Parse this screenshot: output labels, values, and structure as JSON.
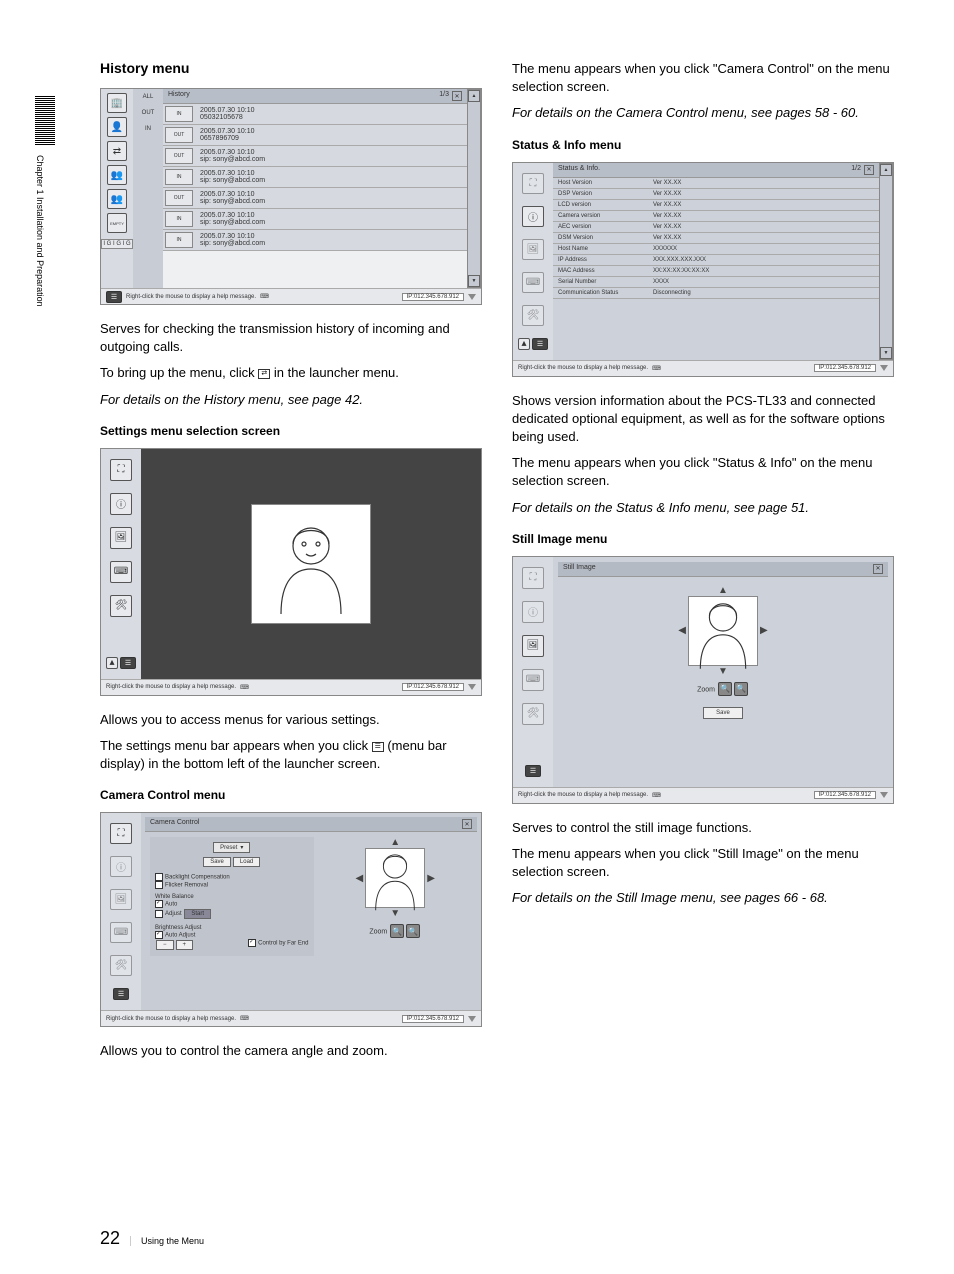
{
  "sidebarLabel": "Chapter 1  Installation and Preparation",
  "pageNumber": "22",
  "footerText": "Using the Menu",
  "left": {
    "history": {
      "heading": "History menu",
      "ss": {
        "title": "History",
        "pageInfo": "1/3",
        "filters": [
          "ALL",
          "OUT",
          "IN"
        ],
        "rows": [
          {
            "dir": "IN",
            "l1": "2005.07.30 10:10",
            "l2": "05032105678"
          },
          {
            "dir": "OUT",
            "l1": "2005.07.30 10:10",
            "l2": "0657896709"
          },
          {
            "dir": "OUT",
            "l1": "2005.07.30 10:10",
            "l2": "sip: sony@abcd.com"
          },
          {
            "dir": "IN",
            "l1": "2005.07.30 10:10",
            "l2": "sip: sony@abcd.com"
          },
          {
            "dir": "OUT",
            "l1": "2005.07.30 10:10",
            "l2": "sip: sony@abcd.com"
          },
          {
            "dir": "IN",
            "l1": "2005.07.30 10:10",
            "l2": "sip: sony@abcd.com"
          },
          {
            "dir": "IN",
            "l1": "2005.07.30 10:10",
            "l2": "sip: sony@abcd.com"
          }
        ],
        "launcherBadges": "I G I G I G",
        "help": "Right-click the mouse to display a help message.",
        "ip": "IP:012.345.678.912"
      },
      "p1": "Serves for checking the transmission history of incoming and outgoing calls.",
      "p2a": "To bring up the menu, click ",
      "p2b": " in the launcher menu.",
      "p3": "For details on the History menu, see page 42."
    },
    "settings": {
      "heading": "Settings menu selection screen",
      "ss": {
        "help": "Right-click the mouse to display a help message.",
        "ip": "IP:012.345.678.912"
      },
      "p1": "Allows you to access menus for various settings.",
      "p2a": "The settings menu bar appears when you click ",
      "p2b": " (menu bar display) in the bottom left of the launcher screen.",
      "h3": "Camera Control menu"
    },
    "camera": {
      "ss": {
        "title": "Camera Control",
        "preset": "Preset",
        "save": "Save",
        "load": "Load",
        "backlight": "Backlight Compensation",
        "flicker": "Flicker Removal",
        "wb": "White Balance",
        "auto": "Auto",
        "adjust": "Adjust",
        "start": "Start",
        "brightness": "Brightness Adjust",
        "autoAdjust": "Auto Adjust",
        "ctrlFar": "Control by Far End",
        "zoom": "Zoom",
        "help": "Right-click the mouse to display a help message.",
        "ip": "IP:012.345.678.912"
      },
      "p1": "Allows you to control the camera angle and zoom."
    }
  },
  "right": {
    "topP1": "The menu appears when you click \"Camera Control\" on the menu selection screen.",
    "topP2": "For details on the Camera Control menu, see pages 58 - 60.",
    "status": {
      "heading": "Status & Info menu",
      "ss": {
        "title": "Status & Info.",
        "pageInfo": "1/2",
        "rows": [
          {
            "k": "Host Version",
            "v": "Ver XX.XX"
          },
          {
            "k": "DSP Version",
            "v": "Ver XX.XX"
          },
          {
            "k": "LCD version",
            "v": "Ver XX.XX"
          },
          {
            "k": "Camera version",
            "v": "Ver XX.XX"
          },
          {
            "k": "AEC version",
            "v": "Ver XX.XX"
          },
          {
            "k": "DSM Version",
            "v": "Ver XX.XX"
          },
          {
            "k": "Host Name",
            "v": "XXXXXX"
          },
          {
            "k": "IP Address",
            "v": "XXX.XXX.XXX.XXX"
          },
          {
            "k": "MAC Address",
            "v": "XX:XX:XX:XX:XX:XX"
          },
          {
            "k": "Serial Number",
            "v": "XXXX"
          },
          {
            "k": "Communication Status",
            "v": "Disconnecting"
          }
        ],
        "help": "Right-click the mouse to display a help message.",
        "ip": "IP:012.345.678.912"
      },
      "p1": "Shows version information about the PCS-TL33 and connected dedicated optional equipment, as well as for the software options being used.",
      "p2": "The menu appears when you click \"Status & Info\" on the menu selection screen.",
      "p3": "For details on the Status & Info menu, see page 51."
    },
    "still": {
      "heading": "Still Image menu",
      "ss": {
        "title": "Still Image",
        "zoom": "Zoom",
        "save": "Save",
        "help": "Right-click the mouse to display a help message.",
        "ip": "IP:012.345.678.912"
      },
      "p1": "Serves to control the still image functions.",
      "p2": "The menu appears when you click \"Still Image\" on the menu selection screen.",
      "p3": "For details on the Still Image menu, see pages 66 - 68."
    }
  }
}
